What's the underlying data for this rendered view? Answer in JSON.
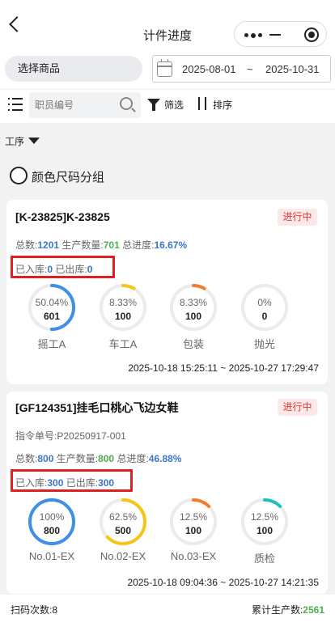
{
  "nav": {
    "title": "计件进度"
  },
  "filters": {
    "select_goods": "选择商品",
    "date_start": "2025-08-01",
    "date_sep": "~",
    "date_end": "2025-10-31",
    "staff_placeholder": "职员编号",
    "filter_label": "筛选",
    "sort_label": "排序",
    "process_label": "工序",
    "group_label": "颜色尺码分组"
  },
  "labels": {
    "total": "总数:",
    "produced": "生产数量:",
    "progress": "总进度:",
    "stored": "已入库:",
    "shipped": "已出库:",
    "order_prefix": "指令单号:",
    "time_sep": " ~ "
  },
  "cards": [
    {
      "title": "[K-23825]K-23825",
      "status": "进行中",
      "total": "1201",
      "produced": "701",
      "progress": "16.67%",
      "stored": "0",
      "shipped": "0",
      "steps": [
        {
          "name": "摇工A",
          "percent": "50.04%",
          "value": "601",
          "fraction": 0.5004,
          "color": "#3d8fe8"
        },
        {
          "name": "车工A",
          "percent": "8.33%",
          "value": "100",
          "fraction": 0.0833,
          "color": "#f5c518"
        },
        {
          "name": "包装",
          "percent": "8.33%",
          "value": "100",
          "fraction": 0.0833,
          "color": "#f57c2b"
        },
        {
          "name": "抛光",
          "percent": "0%",
          "value": "0",
          "fraction": 0,
          "color": "#1fc3b8"
        }
      ],
      "start_time": "2025-10-18 15:25:11",
      "end_time": "2025-10-27 17:29:47"
    },
    {
      "title": "[GF124351]挂毛口桃心飞边女鞋",
      "status": "进行中",
      "order_no": "P20250917-001",
      "total": "800",
      "produced": "800",
      "progress": "46.88%",
      "stored": "300",
      "shipped": "300",
      "steps": [
        {
          "name": "No.01-EX",
          "percent": "100%",
          "value": "800",
          "fraction": 1.0,
          "color": "#3d8fe8"
        },
        {
          "name": "No.02-EX",
          "percent": "62.5%",
          "value": "500",
          "fraction": 0.625,
          "color": "#f5c518"
        },
        {
          "name": "No.03-EX",
          "percent": "12.5%",
          "value": "100",
          "fraction": 0.125,
          "color": "#f57c2b"
        },
        {
          "name": "质检",
          "percent": "12.5%",
          "value": "100",
          "fraction": 0.125,
          "color": "#1fc3b8"
        }
      ],
      "start_time": "2025-10-18 09:04:36",
      "end_time": "2025-10-27 14:21:35"
    }
  ],
  "footer": {
    "scan_label": "扫码次数:",
    "scan_count": "8",
    "total_label": "累计生产数:",
    "total_value": "2561"
  }
}
